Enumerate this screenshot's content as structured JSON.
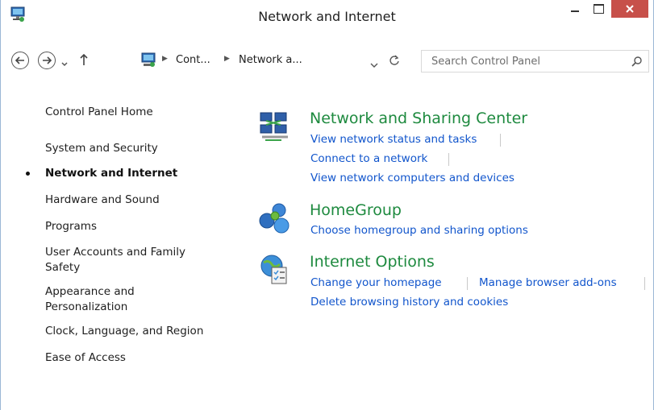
{
  "window": {
    "title": "Network and Internet",
    "close_color": "#c7504a",
    "app_icon": "network-monitor-icon"
  },
  "address": {
    "crumbs": [
      "Cont...",
      "Network a..."
    ],
    "icons": [
      "back-arrow-icon",
      "forward-arrow-icon",
      "recent-dropdown-icon",
      "up-arrow-icon",
      "refresh-icon"
    ]
  },
  "search": {
    "placeholder": "Search Control Panel",
    "icon": "search-icon"
  },
  "sidebar": {
    "items": [
      {
        "label": "Control Panel Home"
      },
      {
        "label": "System and Security"
      },
      {
        "label": "Network and Internet",
        "active": true
      },
      {
        "label": "Hardware and Sound"
      },
      {
        "label": "Programs"
      },
      {
        "label": "User Accounts and Family Safety"
      },
      {
        "label": "Appearance and Personalization"
      },
      {
        "label": "Clock, Language, and Region"
      },
      {
        "label": "Ease of Access"
      }
    ]
  },
  "categories": [
    {
      "title": "Network and Sharing Center",
      "icon": "network-sharing-center-icon",
      "links": [
        "View network status and tasks",
        "Connect to a network",
        "View network computers and devices"
      ]
    },
    {
      "title": "HomeGroup",
      "icon": "homegroup-icon",
      "links": [
        "Choose homegroup and sharing options"
      ]
    },
    {
      "title": "Internet Options",
      "icon": "internet-options-icon",
      "links": [
        "Change your homepage",
        "Manage browser add-ons",
        "Delete browsing history and cookies"
      ]
    }
  ],
  "colors": {
    "link": "#1155cc",
    "category_title": "#1e8a3f"
  }
}
